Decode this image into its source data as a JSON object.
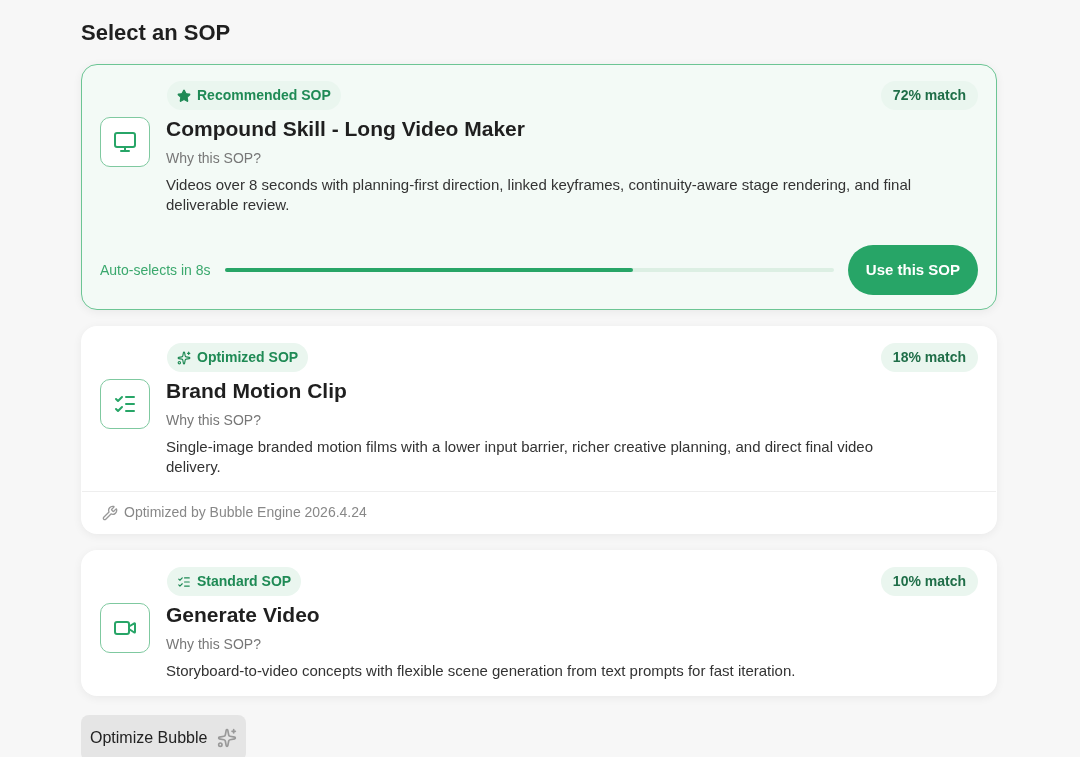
{
  "title": "Select an SOP",
  "sops": [
    {
      "kind": "recommended",
      "selected": true,
      "badge": "Recommended SOP",
      "match": "72% match",
      "name": "Compound Skill - Long Video Maker",
      "why_label": "Why this SOP?",
      "description": "Videos over 8 seconds with planning-first direction, linked keyframes, continuity-aware stage rendering, and final deliverable review.",
      "auto_select": {
        "label": "Auto-selects in 8s",
        "level": 0.67
      },
      "action": "Use this SOP"
    },
    {
      "kind": "optimized",
      "selected": false,
      "badge": "Optimized SOP",
      "match": "18% match",
      "name": "Brand Motion Clip",
      "why_label": "Why this SOP?",
      "description": "Single-image branded motion films with a lower input barrier, richer creative planning, and direct final video delivery.",
      "footer": "Optimized by Bubble Engine 2026.4.24"
    },
    {
      "kind": "standard",
      "selected": false,
      "badge": "Standard SOP",
      "match": "10% match",
      "name": "Generate Video",
      "why_label": "Why this SOP?",
      "description": "Storyboard-to-video concepts with flexible scene generation from text prompts for fast iteration."
    }
  ],
  "optimize_button": "Optimize Bubble"
}
